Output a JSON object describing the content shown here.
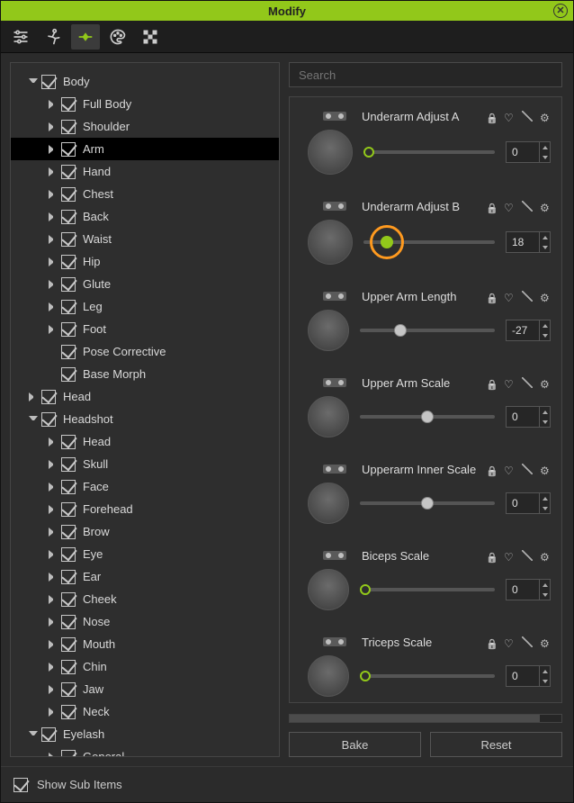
{
  "window": {
    "title": "Modify"
  },
  "search": {
    "placeholder": "Search"
  },
  "footer": {
    "show_sub_items": "Show Sub Items"
  },
  "actions": {
    "bake": "Bake",
    "reset": "Reset"
  },
  "tree": [
    {
      "depth": 0,
      "arrow": "down",
      "label": "Body"
    },
    {
      "depth": 1,
      "arrow": "right",
      "label": "Full Body"
    },
    {
      "depth": 1,
      "arrow": "right",
      "label": "Shoulder"
    },
    {
      "depth": 1,
      "arrow": "right",
      "label": "Arm",
      "selected": true
    },
    {
      "depth": 1,
      "arrow": "right",
      "label": "Hand"
    },
    {
      "depth": 1,
      "arrow": "right",
      "label": "Chest"
    },
    {
      "depth": 1,
      "arrow": "right",
      "label": "Back"
    },
    {
      "depth": 1,
      "arrow": "right",
      "label": "Waist"
    },
    {
      "depth": 1,
      "arrow": "right",
      "label": "Hip"
    },
    {
      "depth": 1,
      "arrow": "right",
      "label": "Glute"
    },
    {
      "depth": 1,
      "arrow": "right",
      "label": "Leg"
    },
    {
      "depth": 1,
      "arrow": "right",
      "label": "Foot"
    },
    {
      "depth": 1,
      "arrow": "none",
      "label": "Pose Corrective"
    },
    {
      "depth": 1,
      "arrow": "none",
      "label": "Base Morph"
    },
    {
      "depth": 0,
      "arrow": "right",
      "label": "Head"
    },
    {
      "depth": 0,
      "arrow": "down",
      "label": "Headshot"
    },
    {
      "depth": 1,
      "arrow": "right",
      "label": "Head"
    },
    {
      "depth": 1,
      "arrow": "right",
      "label": "Skull"
    },
    {
      "depth": 1,
      "arrow": "right",
      "label": "Face"
    },
    {
      "depth": 1,
      "arrow": "right",
      "label": "Forehead"
    },
    {
      "depth": 1,
      "arrow": "right",
      "label": "Brow"
    },
    {
      "depth": 1,
      "arrow": "right",
      "label": "Eye"
    },
    {
      "depth": 1,
      "arrow": "right",
      "label": "Ear"
    },
    {
      "depth": 1,
      "arrow": "right",
      "label": "Cheek"
    },
    {
      "depth": 1,
      "arrow": "right",
      "label": "Nose"
    },
    {
      "depth": 1,
      "arrow": "right",
      "label": "Mouth"
    },
    {
      "depth": 1,
      "arrow": "right",
      "label": "Chin"
    },
    {
      "depth": 1,
      "arrow": "right",
      "label": "Jaw"
    },
    {
      "depth": 1,
      "arrow": "right",
      "label": "Neck"
    },
    {
      "depth": 0,
      "arrow": "down",
      "label": "Eyelash"
    },
    {
      "depth": 1,
      "arrow": "right",
      "label": "General"
    }
  ],
  "params": [
    {
      "name": "Underarm Adjust A",
      "value": "0",
      "pos": 4,
      "style": "green-ring",
      "big": true,
      "highlight": false
    },
    {
      "name": "Underarm Adjust B",
      "value": "18",
      "pos": 18,
      "style": "green-solid",
      "big": true,
      "highlight": true
    },
    {
      "name": "Upper Arm Length",
      "value": "-27",
      "pos": 30,
      "style": "gray",
      "big": false,
      "highlight": false
    },
    {
      "name": "Upper Arm Scale",
      "value": "0",
      "pos": 50,
      "style": "gray",
      "big": false,
      "highlight": false
    },
    {
      "name": "Upperarm Inner Scale",
      "value": "0",
      "pos": 50,
      "style": "gray",
      "big": false,
      "highlight": false
    },
    {
      "name": "Biceps Scale",
      "value": "0",
      "pos": 4,
      "style": "green-ring",
      "big": false,
      "highlight": false
    },
    {
      "name": "Triceps Scale",
      "value": "0",
      "pos": 4,
      "style": "green-ring",
      "big": false,
      "highlight": false
    }
  ]
}
